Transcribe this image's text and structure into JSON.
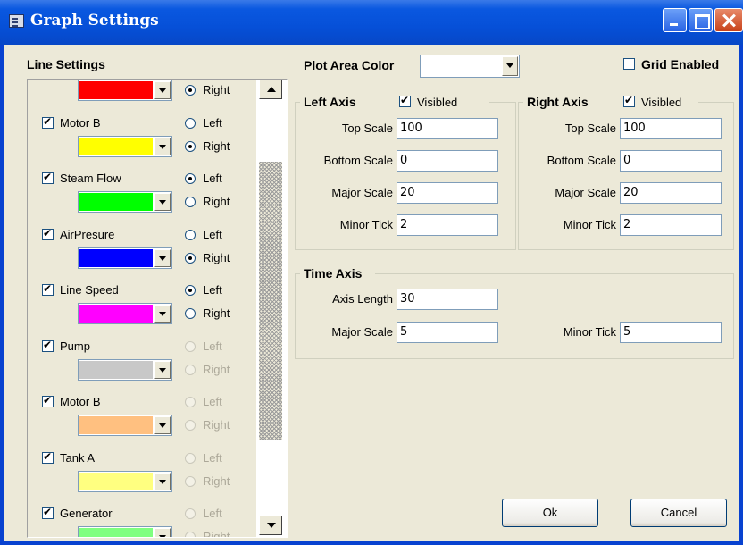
{
  "window": {
    "title": "Graph Settings"
  },
  "line_settings": {
    "header": "Line Settings",
    "left_label": "Left",
    "right_label": "Right",
    "items": [
      {
        "label": "",
        "checked": true,
        "color": "#ff0000",
        "side": "right",
        "enabled": true
      },
      {
        "label": "Motor B",
        "checked": true,
        "color": "#ffff00",
        "side": "right",
        "enabled": true
      },
      {
        "label": "Steam Flow",
        "checked": true,
        "color": "#00ff00",
        "side": "left",
        "enabled": true
      },
      {
        "label": "AirPresure",
        "checked": true,
        "color": "#0000ff",
        "side": "right",
        "enabled": true
      },
      {
        "label": "Line Speed",
        "checked": true,
        "color": "#ff00ff",
        "side": "left",
        "enabled": true
      },
      {
        "label": "Pump",
        "checked": true,
        "color": "#c8c8c8",
        "side": "none",
        "enabled": false
      },
      {
        "label": "Motor B",
        "checked": true,
        "color": "#ffc080",
        "side": "none",
        "enabled": false
      },
      {
        "label": "Tank A",
        "checked": true,
        "color": "#ffff80",
        "side": "none",
        "enabled": false
      },
      {
        "label": "Generator",
        "checked": true,
        "color": "#80ff80",
        "side": "none",
        "enabled": false
      }
    ]
  },
  "plot_area": {
    "label": "Plot Area Color",
    "color": "#ffffff"
  },
  "grid": {
    "label": "Grid Enabled",
    "checked": false
  },
  "left_axis": {
    "title": "Left Axis",
    "visible_label": "Visibled",
    "visible": true,
    "top_scale_label": "Top Scale",
    "top_scale": "100",
    "bottom_scale_label": "Bottom Scale",
    "bottom_scale": "0",
    "major_scale_label": "Major Scale",
    "major_scale": "20",
    "minor_tick_label": "Minor Tick",
    "minor_tick": "2"
  },
  "right_axis": {
    "title": "Right Axis",
    "visible_label": "Visibled",
    "visible": true,
    "top_scale_label": "Top Scale",
    "top_scale": "100",
    "bottom_scale_label": "Bottom Scale",
    "bottom_scale": "0",
    "major_scale_label": "Major Scale",
    "major_scale": "20",
    "minor_tick_label": "Minor Tick",
    "minor_tick": "2"
  },
  "time_axis": {
    "title": "Time Axis",
    "axis_length_label": "Axis Length",
    "axis_length": "30",
    "major_scale_label": "Major Scale",
    "major_scale": "5",
    "minor_tick_label": "Minor Tick",
    "minor_tick": "5"
  },
  "buttons": {
    "ok": "Ok",
    "cancel": "Cancel"
  }
}
